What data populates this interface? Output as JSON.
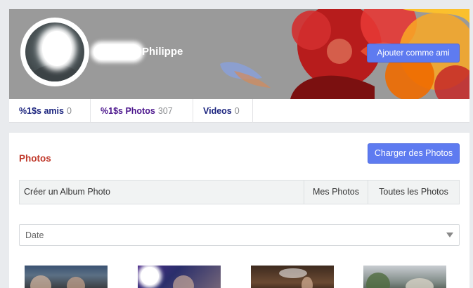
{
  "profile": {
    "name": "Philippe",
    "add_friend_label": "Ajouter comme ami"
  },
  "stats": [
    {
      "label": "%1$s amis",
      "count": "0",
      "color": "#1a237e"
    },
    {
      "label": "%1$s Photos",
      "count": "307",
      "color": "#4a148c"
    },
    {
      "label": "Videos",
      "count": "0",
      "color": "#1a237e"
    }
  ],
  "photos": {
    "title": "Photos",
    "upload_label": "Charger des Photos",
    "tabs": {
      "create": "Créer un Album Photo",
      "mine": "Mes Photos",
      "all": "Toutes les Photos"
    },
    "sort_selected": "Date",
    "thumbnails": [
      "photo-1",
      "photo-2",
      "photo-3",
      "photo-4"
    ]
  },
  "colors": {
    "accent_button": "#5e7bf0",
    "title_red": "#c0392b",
    "cover_gray": "#9a9a9a"
  }
}
